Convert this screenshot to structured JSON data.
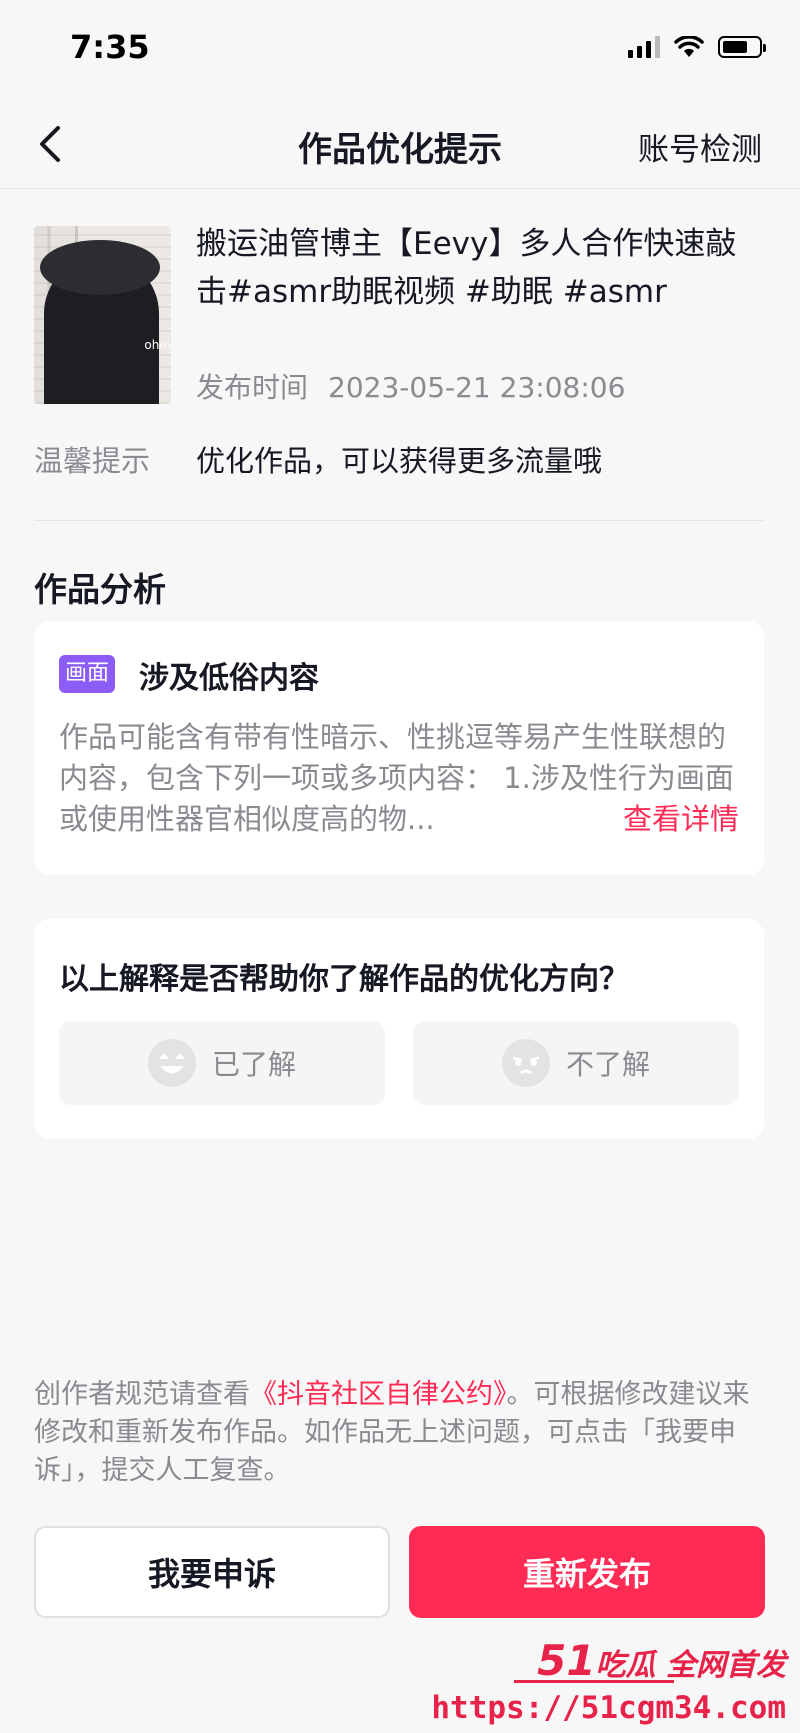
{
  "status_bar": {
    "time": "7:35"
  },
  "nav": {
    "title": "作品优化提示",
    "right_action": "账号检测"
  },
  "video": {
    "title": "搬运油管博主【Eevy】多人合作快速敲击#asmr助眠视频 #助眠 #asmr",
    "thumbnail_watermark": "ohm",
    "publish_label": "发布时间",
    "publish_time": "2023-05-21 23:08:06",
    "tip_label": "温馨提示",
    "tip_text": "优化作品，可以获得更多流量哦"
  },
  "analysis": {
    "section_title": "作品分析",
    "tag": "画面",
    "issue_title": "涉及低俗内容",
    "description": "作品可能含有带有性暗示、性挑逗等易产生性联想的内容，包含下列一项或多项内容： 1.涉及性行为画面或使用性器官相似度高的物...",
    "view_more": "查看详情"
  },
  "feedback": {
    "question": "以上解释是否帮助你了解作品的优化方向？",
    "yes_label": "已了解",
    "no_label": "不了解",
    "yes_icon": "happy-face-icon",
    "no_icon": "sad-face-icon"
  },
  "footer": {
    "note_prefix": "创作者规范请查看",
    "note_link": "《抖音社区自律公约》",
    "note_suffix": "。可根据修改建议来修改和重新发布作品。如作品无上述问题，可点击「我要申诉」，提交人工复查。"
  },
  "buttons": {
    "appeal": "我要申诉",
    "republish": "重新发布"
  },
  "watermark": {
    "logo_number": "51",
    "logo_text": "吃瓜 全网首发",
    "url": "https://51cgm34.com"
  },
  "colors": {
    "accent": "#fe2c55",
    "tag": "#8b5cf6",
    "muted_text": "#8a8b91"
  }
}
